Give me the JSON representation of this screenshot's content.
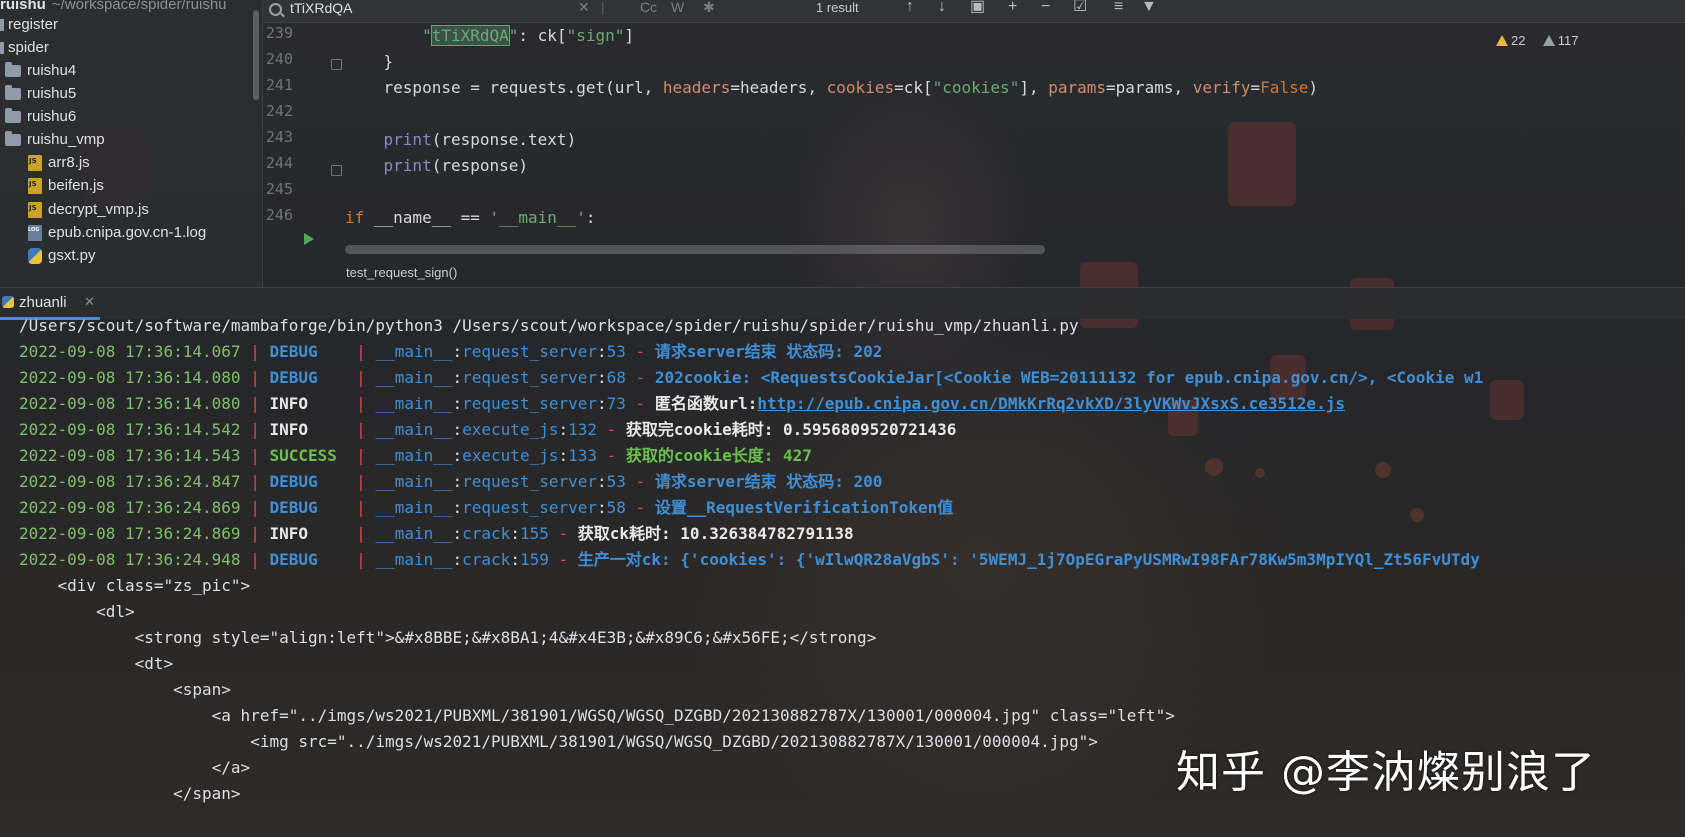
{
  "sidebar": {
    "root_item": {
      "name": "ruishu",
      "path": "~/workspace/spider/ruishu"
    },
    "items": [
      {
        "label": "register",
        "type": "folder"
      },
      {
        "label": "spider",
        "type": "folder"
      },
      {
        "label": "ruishu4",
        "type": "folder"
      },
      {
        "label": "ruishu5",
        "type": "folder"
      },
      {
        "label": "ruishu6",
        "type": "folder"
      },
      {
        "label": "ruishu_vmp",
        "type": "folder"
      },
      {
        "label": "arr8.js",
        "type": "js"
      },
      {
        "label": "beifen.js",
        "type": "js"
      },
      {
        "label": "decrypt_vmp.js",
        "type": "js"
      },
      {
        "label": "epub.cnipa.gov.cn-1.log",
        "type": "log"
      },
      {
        "label": "gsxt.py",
        "type": "py"
      }
    ]
  },
  "search": {
    "query": "tTiXRdQA",
    "result_count": "1 result",
    "case_btn": "Cc",
    "word_btn": "W"
  },
  "editor": {
    "line_numbers": [
      "239",
      "240",
      "241",
      "242",
      "243",
      "244",
      "245",
      "246"
    ],
    "lines": {
      "l239": {
        "indent": "        ",
        "q_open": "\"",
        "match": "tTiXRdQA",
        "q_close": "\"",
        "rest": ": ck[",
        "str": "\"sign\"",
        "end": "]"
      },
      "l240": "    }",
      "l241": {
        "a": "    response = requests.get(url, ",
        "p1": "headers",
        "e1": "=headers, ",
        "p2": "cookies",
        "e2": "=ck[",
        "s2": "\"cookies\"",
        "e2b": "], ",
        "p3": "params",
        "e3": "=params, ",
        "p4": "verify",
        "e4": "=",
        "v4": "False",
        "e5": ")"
      },
      "l243": {
        "indent": "    ",
        "fn": "print",
        "rest": "(response.text)"
      },
      "l244": {
        "indent": "    ",
        "fn": "print",
        "rest": "(response)"
      },
      "l246": {
        "kw": "if",
        "mid": " __name__ == ",
        "str": "'__main__'",
        "end": ":"
      }
    },
    "warnings": {
      "count_a": "22",
      "count_b": "117"
    },
    "breadcrumb": "test_request_sign()"
  },
  "run_panel": {
    "tab_label": "zhuanli",
    "command": "/Users/scout/software/mambaforge/bin/python3 /Users/scout/workspace/spider/ruishu/spider/ruishu_vmp/zhuanli.py",
    "logs": [
      {
        "ts": "2022-09-08 17:36:14.067",
        "level": "DEBUG",
        "mod": "__main__",
        "fn": "request_server",
        "line": "53",
        "msg": "请求server结束 状态码: 202"
      },
      {
        "ts": "2022-09-08 17:36:14.080",
        "level": "DEBUG",
        "mod": "__main__",
        "fn": "request_server",
        "line": "68",
        "msg": "202cookie: <RequestsCookieJar[<Cookie WEB=20111132 for epub.cnipa.gov.cn/>, <Cookie w1"
      },
      {
        "ts": "2022-09-08 17:36:14.080",
        "level": "INFO",
        "mod": "__main__",
        "fn": "request_server",
        "line": "73",
        "msg_prefix": "匿名函数url:",
        "link": "http://epub.cnipa.gov.cn/DMkKrRq2vkXD/3lyVKWvJXsxS.ce3512e.js"
      },
      {
        "ts": "2022-09-08 17:36:14.542",
        "level": "INFO",
        "mod": "__main__",
        "fn": "execute_js",
        "line": "132",
        "msg": "获取完cookie耗时: 0.5956809520721436"
      },
      {
        "ts": "2022-09-08 17:36:14.543",
        "level": "SUCCESS",
        "mod": "__main__",
        "fn": "execute_js",
        "line": "133",
        "msg": "获取的cookie长度: 427"
      },
      {
        "ts": "2022-09-08 17:36:24.847",
        "level": "DEBUG",
        "mod": "__main__",
        "fn": "request_server",
        "line": "53",
        "msg": "请求server结束 状态码: 200"
      },
      {
        "ts": "2022-09-08 17:36:24.869",
        "level": "DEBUG",
        "mod": "__main__",
        "fn": "request_server",
        "line": "58",
        "msg": "设置__RequestVerificationToken值"
      },
      {
        "ts": "2022-09-08 17:36:24.869",
        "level": "INFO",
        "mod": "__main__",
        "fn": "crack",
        "line": "155",
        "msg": "获取ck耗时: 10.326384782791138"
      },
      {
        "ts": "2022-09-08 17:36:24.948",
        "level": "DEBUG",
        "mod": "__main__",
        "fn": "crack",
        "line": "159",
        "msg": "生产一对ck: {'cookies': {'wIlwQR28aVgbS': '5WEMJ_1j7OpEGraPyUSMRwI98FAr78Kw5m3MpIYQl_Zt56FvUTdy"
      }
    ],
    "html_lines": [
      "    <div class=\"zs_pic\">",
      "        <dl>",
      "            <strong style=\"align:left\">&#x8BBE;&#x8BA1;4&#x4E3B;&#x89C6;&#x56FE;</strong>",
      "            <dt>",
      "                <span>",
      "                    <a href=\"../imgs/ws2021/PUBXML/381901/WGSQ/WGSQ_DZGBD/202130882787X/130001/000004.jpg\" class=\"left\">",
      "                        <img src=\"../imgs/ws2021/PUBXML/381901/WGSQ/WGSQ_DZGBD/202130882787X/130001/000004.jpg\">",
      "                    </a>",
      "                </span>"
    ]
  },
  "watermark": "知乎 @李汭燦别浪了"
}
